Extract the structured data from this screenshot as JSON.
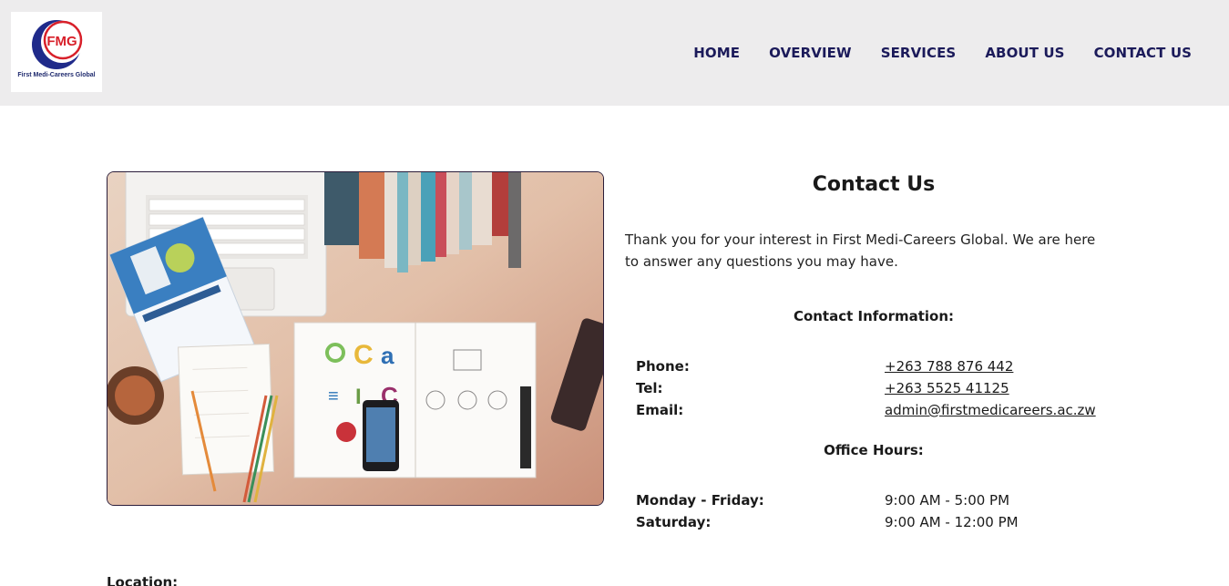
{
  "header": {
    "logo": {
      "initials": "FMG",
      "caption": "First Medi-Careers Global"
    },
    "nav": [
      {
        "label": "HOME"
      },
      {
        "label": "OVERVIEW"
      },
      {
        "label": "SERVICES"
      },
      {
        "label": "ABOUT US"
      },
      {
        "label": "CONTACT US"
      }
    ]
  },
  "colors": {
    "header_bg": "#edeced",
    "nav_text": "#1b1a5a",
    "logo_red": "#d8202a",
    "logo_blue": "#1f2a8a"
  },
  "main": {
    "photo_alt": "desk-with-laptop-books-and-magazines",
    "title": "Contact Us",
    "intro": "Thank you for your interest in First Medi-Careers Global. We are here to answer any questions you may have.",
    "contact_info_heading": "Contact Information:",
    "contact_info": [
      {
        "label": "Phone:",
        "value": "+263 788 876 442"
      },
      {
        "label": "Tel:",
        "value": "+263 5525 41125"
      },
      {
        "label": "Email:",
        "value": "admin@firstmedicareers.ac.zw"
      }
    ],
    "office_hours_heading": "Office Hours:",
    "office_hours": [
      {
        "label": "Monday - Friday:",
        "value": "9:00 AM - 5:00 PM"
      },
      {
        "label": "Saturday:",
        "value": "9:00 AM - 12:00 PM"
      }
    ],
    "location_label": "Location:"
  }
}
